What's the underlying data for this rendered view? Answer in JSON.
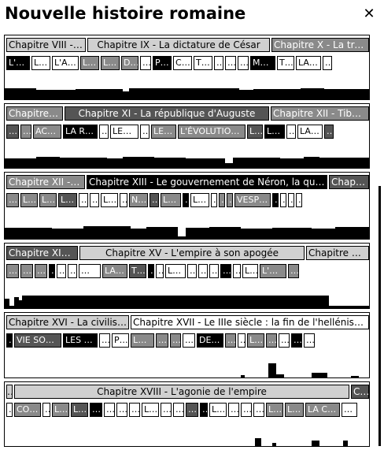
{
  "title": "Nouvelle histoire romaine",
  "close_icon": "close-icon",
  "colors": {
    "black": "#000000",
    "dark": "#555555",
    "mid": "#8a8a8a",
    "light": "#d0d0d0",
    "white": "#ffffff"
  },
  "panels": [
    {
      "chapters": [
        {
          "label": "Chapitre VIII - L'…",
          "tone": "light"
        },
        {
          "label": "Chapitre IX - La dictature de César",
          "tone": "light"
        },
        {
          "label": "Chapitre X - La troisi…",
          "tone": "mid"
        }
      ],
      "sections": [
        {
          "label": "L'A…",
          "tone": "black"
        },
        {
          "label": "L…",
          "tone": "white"
        },
        {
          "label": "L'AN…",
          "tone": "white"
        },
        {
          "label": "LE…",
          "tone": "mid"
        },
        {
          "label": "LE…",
          "tone": "mid"
        },
        {
          "label": "D…",
          "tone": "mid"
        },
        {
          "label": "…",
          "tone": "white"
        },
        {
          "label": "P…",
          "tone": "black"
        },
        {
          "label": "C…",
          "tone": "white"
        },
        {
          "label": "T…",
          "tone": "white"
        },
        {
          "label": "…",
          "tone": "white"
        },
        {
          "label": "…",
          "tone": "white"
        },
        {
          "label": "…",
          "tone": "white"
        },
        {
          "label": "MA…",
          "tone": "black"
        },
        {
          "label": "T…",
          "tone": "white"
        },
        {
          "label": "LA …",
          "tone": "white"
        },
        {
          "label": "…",
          "tone": "white"
        }
      ]
    },
    {
      "chapters": [
        {
          "label": "Chapitre X…",
          "tone": "mid"
        },
        {
          "label": "Chapitre XI - La république d'Auguste",
          "tone": "dark"
        },
        {
          "label": "Chapitre XII - Tibère,…",
          "tone": "mid"
        }
      ],
      "sections": [
        {
          "label": "…",
          "tone": "dark"
        },
        {
          "label": "…",
          "tone": "mid"
        },
        {
          "label": "ACT…",
          "tone": "mid"
        },
        {
          "label": "LA RE…",
          "tone": "black"
        },
        {
          "label": "…",
          "tone": "white"
        },
        {
          "label": "LES …",
          "tone": "white"
        },
        {
          "label": "…",
          "tone": "white"
        },
        {
          "label": "LES …",
          "tone": "mid"
        },
        {
          "label": "L'ÉVOLUTION D…",
          "tone": "mid"
        },
        {
          "label": "L…",
          "tone": "dark"
        },
        {
          "label": "LE…",
          "tone": "black"
        },
        {
          "label": "…",
          "tone": "white"
        },
        {
          "label": "LA …",
          "tone": "white"
        },
        {
          "label": "…",
          "tone": "dark"
        }
      ]
    },
    {
      "chapters": [
        {
          "label": "Chapitre XII - Ti…",
          "tone": "mid"
        },
        {
          "label": "Chapitre XIII - Le gouvernement de Néron, la quatriè…",
          "tone": "black"
        },
        {
          "label": "Chapitr…",
          "tone": "dark"
        }
      ],
      "sections": [
        {
          "label": "…",
          "tone": "mid"
        },
        {
          "label": "L…",
          "tone": "mid"
        },
        {
          "label": "L…",
          "tone": "mid"
        },
        {
          "label": "LE…",
          "tone": "dark"
        },
        {
          "label": "…",
          "tone": "white"
        },
        {
          "label": "…",
          "tone": "white"
        },
        {
          "label": "L…",
          "tone": "white"
        },
        {
          "label": "…",
          "tone": "white"
        },
        {
          "label": "N…",
          "tone": "mid"
        },
        {
          "label": "…",
          "tone": "dark"
        },
        {
          "label": "LE…",
          "tone": "mid"
        },
        {
          "label": "…",
          "tone": "black"
        },
        {
          "label": "LE…",
          "tone": "white"
        },
        {
          "label": "…",
          "tone": "white"
        },
        {
          "label": "…",
          "tone": "mid"
        },
        {
          "label": "…",
          "tone": "mid"
        },
        {
          "label": "VESP…",
          "tone": "mid"
        },
        {
          "label": "…",
          "tone": "black"
        },
        {
          "label": "…",
          "tone": "white"
        },
        {
          "label": "…",
          "tone": "white"
        },
        {
          "label": "…",
          "tone": "white"
        }
      ]
    },
    {
      "chapters": [
        {
          "label": "Chapitre XIV -…",
          "tone": "dark"
        },
        {
          "label": "Chapitre XV - L'empire à son apogée",
          "tone": "light"
        },
        {
          "label": "Chapitre XVI…",
          "tone": "light"
        }
      ],
      "sections": [
        {
          "label": "…",
          "tone": "mid"
        },
        {
          "label": "…",
          "tone": "mid"
        },
        {
          "label": "…",
          "tone": "mid"
        },
        {
          "label": "…",
          "tone": "black"
        },
        {
          "label": "…",
          "tone": "white"
        },
        {
          "label": "…",
          "tone": "white"
        },
        {
          "label": "…",
          "tone": "white"
        },
        {
          "label": "LA …",
          "tone": "mid"
        },
        {
          "label": "T…",
          "tone": "dark"
        },
        {
          "label": "…",
          "tone": "black"
        },
        {
          "label": "…",
          "tone": "white"
        },
        {
          "label": "LE…",
          "tone": "white"
        },
        {
          "label": "…",
          "tone": "white"
        },
        {
          "label": "…",
          "tone": "white"
        },
        {
          "label": "…",
          "tone": "white"
        },
        {
          "label": "…",
          "tone": "black"
        },
        {
          "label": "…",
          "tone": "white"
        },
        {
          "label": "L…",
          "tone": "white"
        },
        {
          "label": "L'ORG…",
          "tone": "mid"
        },
        {
          "label": "…",
          "tone": "mid"
        }
      ]
    },
    {
      "chapters": [
        {
          "label": "Chapitre XVI - La civilisati…",
          "tone": "light"
        },
        {
          "label": "Chapitre XVII - Le IIIe siècle : la fin de l'hellénisme et …",
          "tone": "white"
        }
      ],
      "sections": [
        {
          "label": "…",
          "tone": "black"
        },
        {
          "label": "VIE SOCI…",
          "tone": "dark"
        },
        {
          "label": "LES C…",
          "tone": "black"
        },
        {
          "label": "…",
          "tone": "white"
        },
        {
          "label": "P…",
          "tone": "white"
        },
        {
          "label": "LA …",
          "tone": "mid"
        },
        {
          "label": "…",
          "tone": "mid"
        },
        {
          "label": "…",
          "tone": "mid"
        },
        {
          "label": "…",
          "tone": "white"
        },
        {
          "label": "DE …",
          "tone": "black"
        },
        {
          "label": "…",
          "tone": "mid"
        },
        {
          "label": "…",
          "tone": "white"
        },
        {
          "label": "LE…",
          "tone": "mid"
        },
        {
          "label": "…",
          "tone": "mid"
        },
        {
          "label": "…",
          "tone": "white"
        },
        {
          "label": "…",
          "tone": "black"
        },
        {
          "label": "…",
          "tone": "white"
        }
      ]
    },
    {
      "chapters": [
        {
          "label": "…",
          "tone": "light"
        },
        {
          "label": "Chapitre XVIII - L'agonie de l'empire",
          "tone": "light"
        },
        {
          "label": "C…",
          "tone": "dark"
        }
      ],
      "sections": [
        {
          "label": "…",
          "tone": "white"
        },
        {
          "label": "CO…",
          "tone": "mid"
        },
        {
          "label": "…",
          "tone": "white"
        },
        {
          "label": "L…",
          "tone": "mid"
        },
        {
          "label": "L…",
          "tone": "dark"
        },
        {
          "label": "…",
          "tone": "black"
        },
        {
          "label": "…",
          "tone": "white"
        },
        {
          "label": "…",
          "tone": "white"
        },
        {
          "label": "…",
          "tone": "white"
        },
        {
          "label": "L…",
          "tone": "white"
        },
        {
          "label": "…",
          "tone": "white"
        },
        {
          "label": "…",
          "tone": "white"
        },
        {
          "label": "…",
          "tone": "dark"
        },
        {
          "label": "…",
          "tone": "black"
        },
        {
          "label": "L…",
          "tone": "white"
        },
        {
          "label": "…",
          "tone": "white"
        },
        {
          "label": "…",
          "tone": "white"
        },
        {
          "label": "…",
          "tone": "white"
        },
        {
          "label": "LE…",
          "tone": "mid"
        },
        {
          "label": "LE…",
          "tone": "mid"
        },
        {
          "label": "LA CA…",
          "tone": "mid"
        },
        {
          "label": "…",
          "tone": "white"
        }
      ]
    }
  ]
}
